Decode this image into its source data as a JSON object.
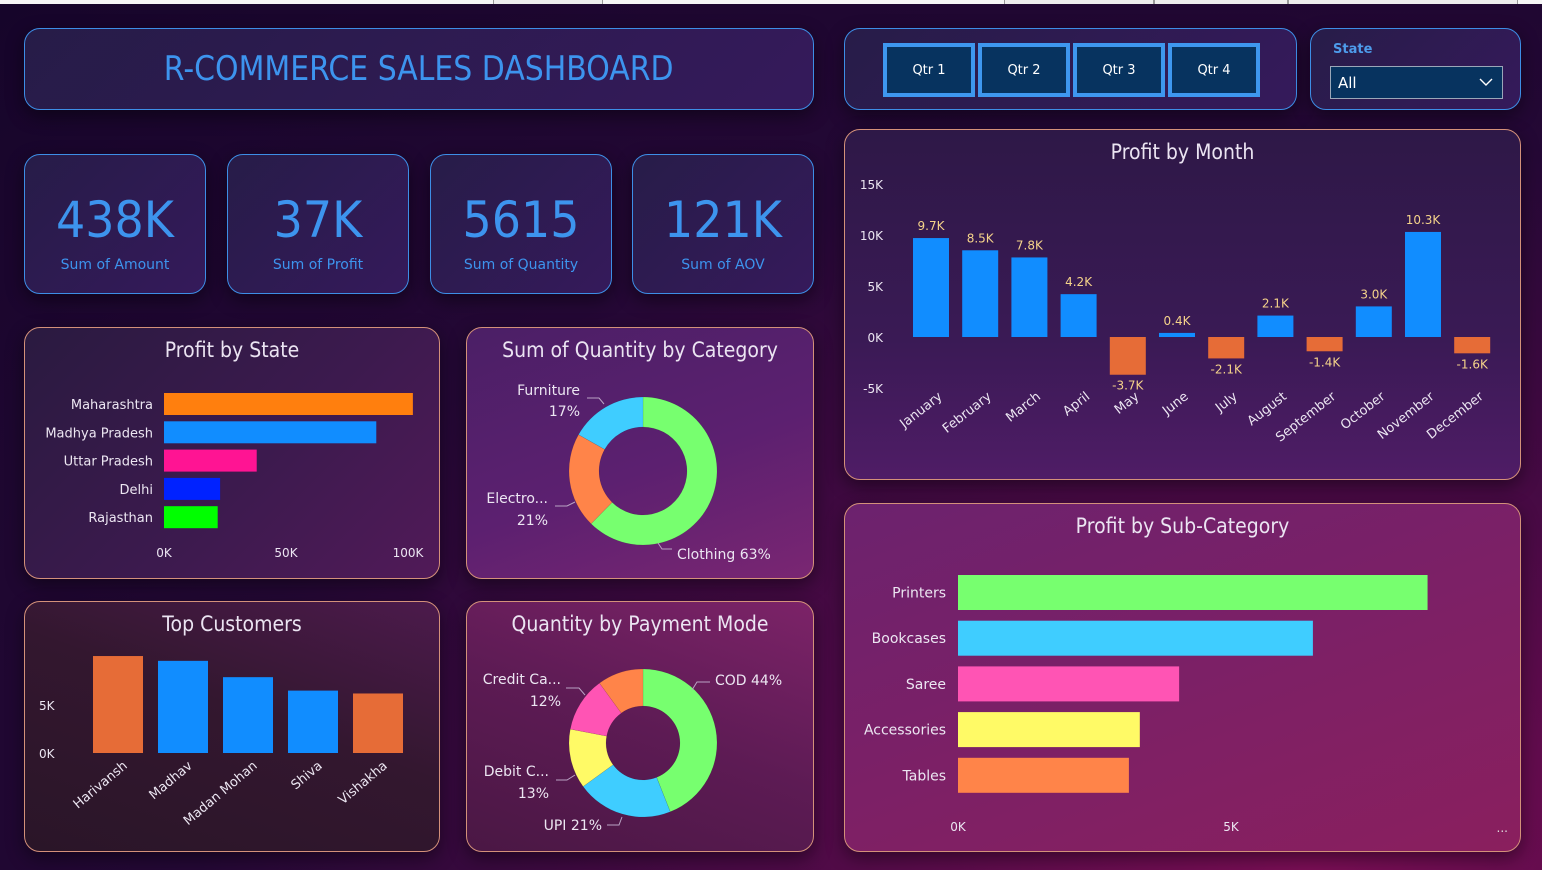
{
  "header": {
    "title": "R-COMMERCE SALES DASHBOARD"
  },
  "quarter_slicer": {
    "buttons": [
      "Qtr 1",
      "Qtr 2",
      "Qtr 3",
      "Qtr 4"
    ]
  },
  "state_filter": {
    "label": "State",
    "selected": "All",
    "icon": "chevron-down-icon"
  },
  "kpis": [
    {
      "value": "438K",
      "label": "Sum of Amount"
    },
    {
      "value": "37K",
      "label": "Sum of Profit"
    },
    {
      "value": "5615",
      "label": "Sum of Quantity"
    },
    {
      "value": "121K",
      "label": "Sum of AOV"
    }
  ],
  "colors": {
    "accent": "#3d94ee",
    "positive_bar": "#118dff",
    "negative_bar": "#e66c37",
    "data_label": "#f5d38a"
  },
  "chart_data": [
    {
      "id": "profit_by_state",
      "type": "bar",
      "orientation": "horizontal",
      "title": "Profit by State",
      "categories": [
        "Maharashtra",
        "Madhya Pradesh",
        "Uttar Pradesh",
        "Delhi",
        "Rajasthan"
      ],
      "values": [
        102000,
        87000,
        38000,
        23000,
        22000
      ],
      "colors": [
        "#ff7f0e",
        "#118dff",
        "#ff1493",
        "#0022ff",
        "#00ff00"
      ],
      "xticks": [
        "0K",
        "50K",
        "100K"
      ],
      "xlim": [
        0,
        100000
      ],
      "grid": false
    },
    {
      "id": "quantity_by_category",
      "type": "pie",
      "donut": true,
      "title": "Sum of Quantity by Category",
      "slices": [
        {
          "label": "Clothing",
          "value": 63,
          "display": "Clothing 63%",
          "color": "#77ff6f"
        },
        {
          "label": "Electro...",
          "value": 21,
          "display": "21%",
          "color": "#ff8449"
        },
        {
          "label": "Furniture",
          "value": 17,
          "display": "17%",
          "color": "#3fcdff"
        }
      ]
    },
    {
      "id": "top_customers",
      "type": "bar",
      "orientation": "vertical",
      "title": "Top Customers",
      "categories": [
        "Harivansh",
        "Madhav",
        "Madan Mohan",
        "Shiva",
        "Vishakha"
      ],
      "values": [
        10100,
        9600,
        7900,
        6500,
        6200
      ],
      "colors": [
        "#e66c37",
        "#118dff",
        "#118dff",
        "#118dff",
        "#e66c37"
      ],
      "yticks": [
        "0K",
        "5K"
      ],
      "ylim": [
        0,
        10000
      ],
      "grid": false
    },
    {
      "id": "quantity_by_payment_mode",
      "type": "pie",
      "donut": true,
      "title": "Quantity by Payment Mode",
      "slices": [
        {
          "label": "COD",
          "value": 44,
          "display": "COD 44%",
          "color": "#77ff6f"
        },
        {
          "label": "UPI",
          "value": 21,
          "display": "UPI 21%",
          "color": "#3fcdff"
        },
        {
          "label": "Debit C...",
          "value": 13,
          "display": "13%",
          "color": "#fffa66"
        },
        {
          "label": "Credit Ca...",
          "value": 12,
          "display": "12%",
          "color": "#ff54b4"
        },
        {
          "label": "",
          "value": 10,
          "display": "",
          "color": "#ff8449"
        }
      ]
    },
    {
      "id": "profit_by_month",
      "type": "bar",
      "orientation": "vertical",
      "title": "Profit by Month",
      "categories": [
        "January",
        "February",
        "March",
        "April",
        "May",
        "June",
        "July",
        "August",
        "September",
        "October",
        "November",
        "December"
      ],
      "values": [
        9700,
        8500,
        7800,
        4200,
        -3700,
        400,
        -2100,
        2100,
        -1400,
        3000,
        10300,
        -1600
      ],
      "data_labels": [
        "9.7K",
        "8.5K",
        "7.8K",
        "4.2K",
        "-3.7K",
        "0.4K",
        "-2.1K",
        "2.1K",
        "-1.4K",
        "3.0K",
        "10.3K",
        "-1.6K"
      ],
      "yticks": [
        "15K",
        "10K",
        "5K",
        "0K",
        "-5K"
      ],
      "ylim": [
        -5000,
        15000
      ],
      "grid": false
    },
    {
      "id": "profit_by_subcategory",
      "type": "bar",
      "orientation": "horizontal",
      "title": "Profit by Sub-Category",
      "categories": [
        "Printers",
        "Bookcases",
        "Saree",
        "Accessories",
        "Tables"
      ],
      "values": [
        8600,
        6500,
        4050,
        3330,
        3130
      ],
      "colors": [
        "#77ff6f",
        "#3fcdff",
        "#ff54b4",
        "#fffa66",
        "#ff8449"
      ],
      "xticks": [
        "0K",
        "5K"
      ],
      "xlim": [
        0,
        5000
      ],
      "more_indicator": "...",
      "grid": false
    }
  ]
}
